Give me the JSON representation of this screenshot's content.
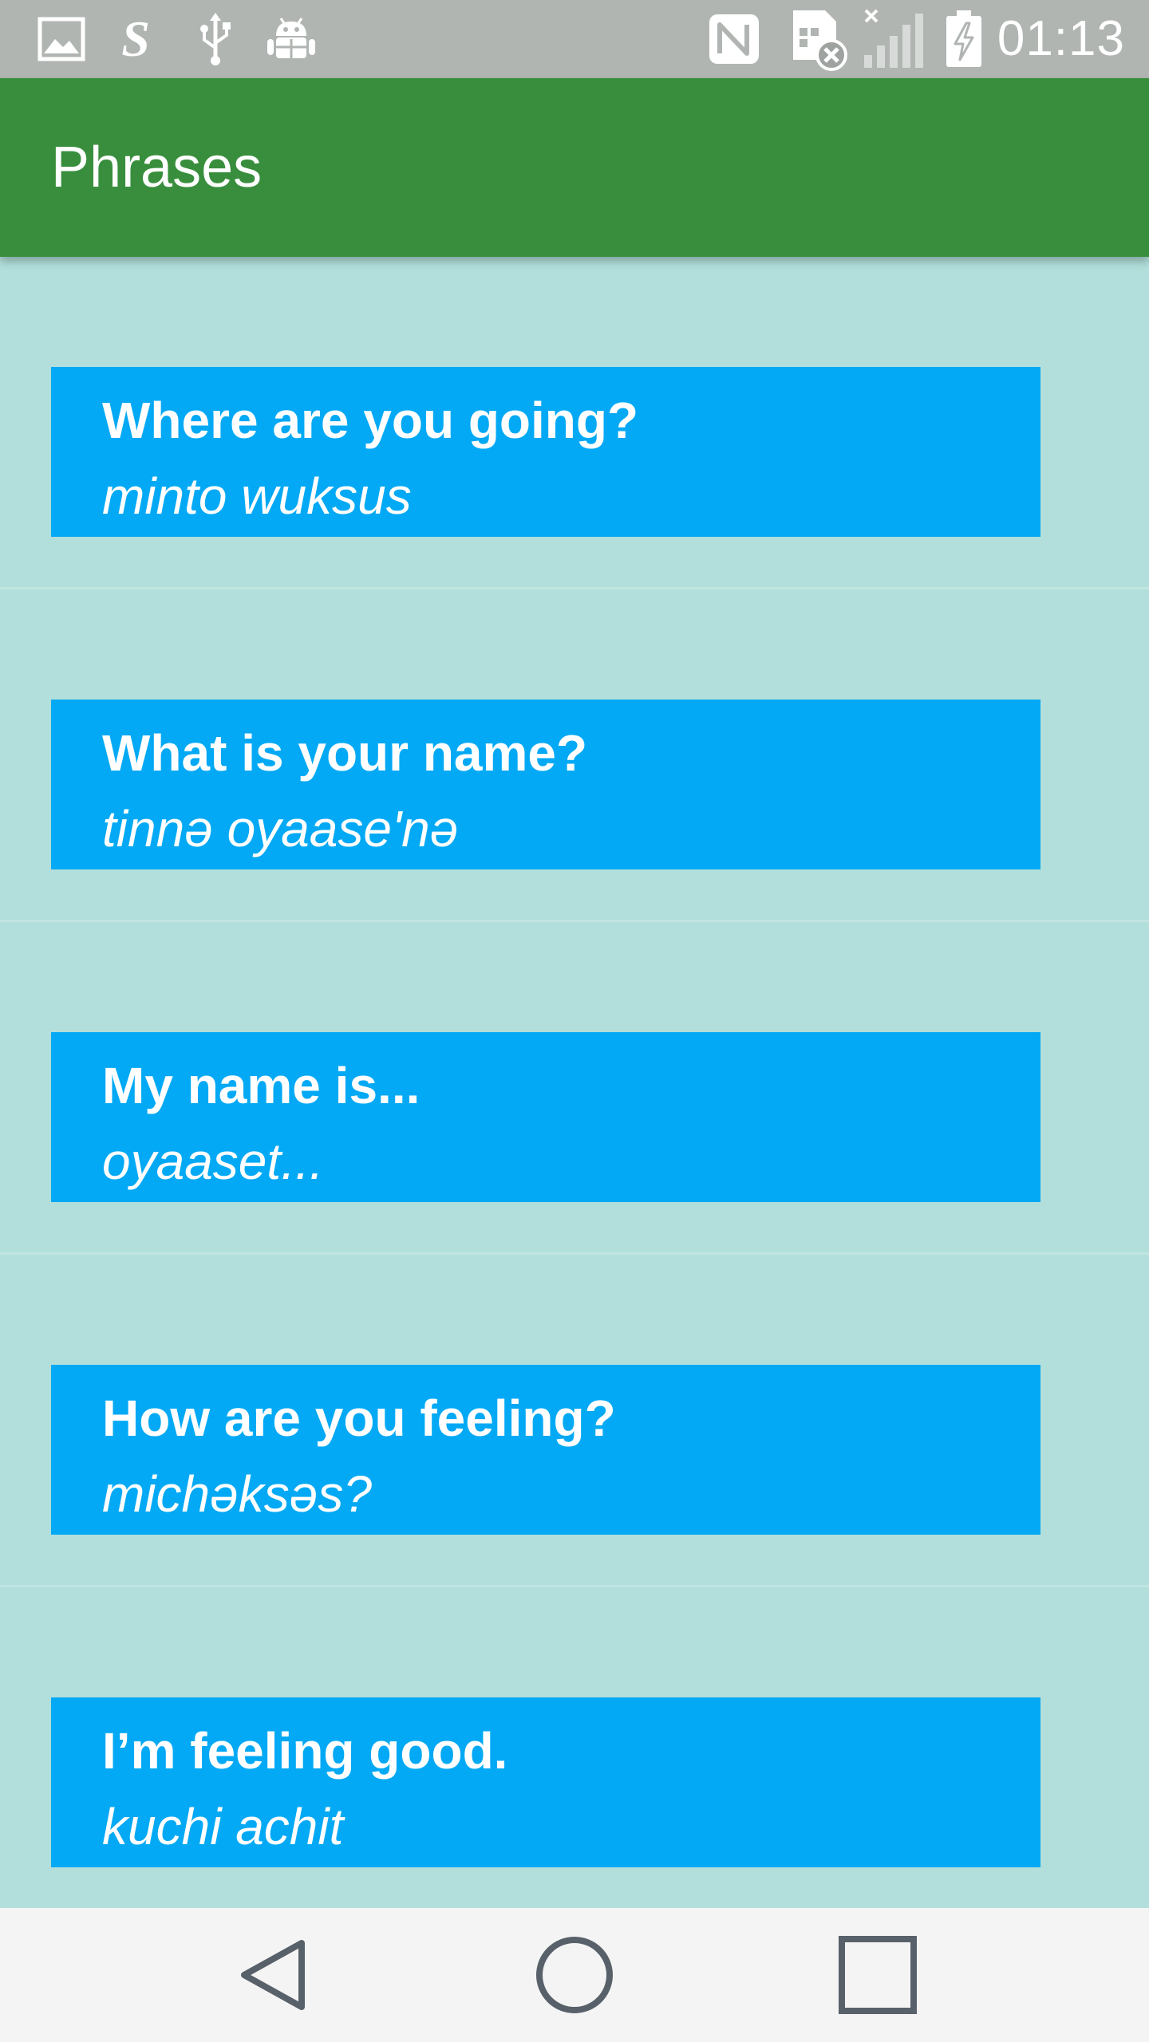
{
  "status_bar": {
    "left_icons": [
      "image-icon",
      "s-app-icon",
      "usb-icon",
      "android-debug-icon"
    ],
    "right_icons": [
      "nfc-icon",
      "sim-missing-icon",
      "signal-icon",
      "battery-charging-icon"
    ],
    "time": "01:13"
  },
  "app_bar": {
    "title": "Phrases",
    "color": "#388E3C"
  },
  "phrases": [
    {
      "english": "Where are you going?",
      "translation": "minto wuksus"
    },
    {
      "english": "What is your name?",
      "translation": "tinnə oyaase'nə"
    },
    {
      "english": "My name is...",
      "translation": "oyaaset..."
    },
    {
      "english": "How are you feeling?",
      "translation": "michəksəs?"
    },
    {
      "english": "I’m feeling good.",
      "translation": "kuchi achit"
    }
  ],
  "colors": {
    "background": "#B2DFDB",
    "card": "#03A9F4",
    "nav_bar": "#F4F4F4"
  },
  "nav_bar": {
    "buttons": [
      "back-icon",
      "home-icon",
      "recents-icon"
    ]
  }
}
